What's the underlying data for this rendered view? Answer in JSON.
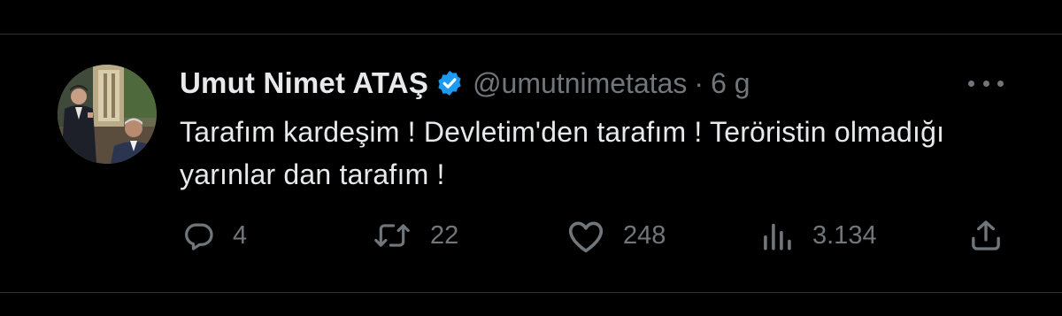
{
  "tweet": {
    "display_name": "Umut Nimet ATAŞ",
    "handle": "@umutnimetatas",
    "separator": "·",
    "time": "6 g",
    "text": "Tarafım kardeşim ! Devletim'den tarafım ! Teröristin olmadığı yarınlar dan tarafım !",
    "verified": true
  },
  "actions": {
    "reply": {
      "icon": "reply-icon",
      "count": "4"
    },
    "retweet": {
      "icon": "retweet-icon",
      "count": "22"
    },
    "like": {
      "icon": "heart-icon",
      "count": "248"
    },
    "views": {
      "icon": "views-icon",
      "count": "3.134"
    },
    "share": {
      "icon": "share-icon"
    }
  },
  "colors": {
    "background": "#000000",
    "text": "#e7e9ea",
    "secondary": "#71767b",
    "divider": "#2f3336",
    "verified": "#1d9bf0"
  }
}
